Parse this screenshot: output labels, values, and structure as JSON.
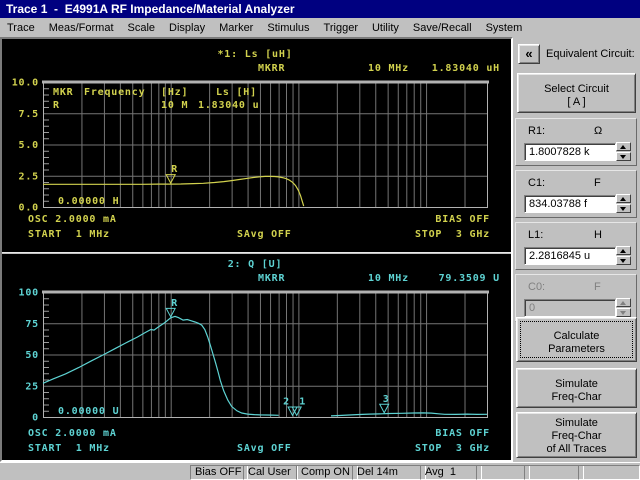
{
  "window_title": "Trace 1  -  E4991A RF Impedance/Material Analyzer",
  "menu": {
    "items": [
      "Trace",
      "Meas/Format",
      "Scale",
      "Display",
      "Marker",
      "Stimulus",
      "Trigger",
      "Utility",
      "Save/Recall",
      "System"
    ]
  },
  "colors": {
    "titlebar": "#000080",
    "trace1": "#d2d24e",
    "trace2": "#5ed3d3",
    "grid": "#757575",
    "plot_border": "#b2b2b2"
  },
  "chart_data": [
    {
      "type": "line",
      "title": "*1: Ls [uH]",
      "readout": {
        "mkr": "MKRR",
        "freq": "10 MHz",
        "value": "1.83040 uH"
      },
      "marker_table": {
        "columns": [
          "MKR",
          "Frequency",
          "[Hz]",
          "Ls [H]"
        ],
        "row": [
          "R",
          "10 M",
          "1.83040 u"
        ]
      },
      "ref_label": "0.00000 H",
      "ylabel_ticks": [
        "10.0",
        "7.5",
        "5.0",
        "2.5",
        "0.0"
      ],
      "ylim": [
        0,
        10
      ],
      "xmin_mhz": 1,
      "xmax_mhz": 3000,
      "xscale": "log",
      "color": "#d2d24e",
      "series": [
        {
          "name": "Ls",
          "segments": [
            [
              [
                1,
                1.82
              ],
              [
                1.5,
                1.82
              ],
              [
                2,
                1.82
              ],
              [
                3,
                1.82
              ],
              [
                4,
                1.82
              ],
              [
                5,
                1.82
              ],
              [
                6,
                1.82
              ],
              [
                8,
                1.83
              ],
              [
                10,
                1.83
              ],
              [
                12,
                1.84
              ],
              [
                15,
                1.87
              ],
              [
                18,
                1.9
              ],
              [
                22,
                1.96
              ],
              [
                26,
                2.03
              ],
              [
                30,
                2.11
              ],
              [
                35,
                2.21
              ],
              [
                40,
                2.3
              ],
              [
                45,
                2.37
              ],
              [
                50,
                2.42
              ],
              [
                55,
                2.445
              ],
              [
                60,
                2.45
              ],
              [
                65,
                2.44
              ],
              [
                70,
                2.41
              ],
              [
                75,
                2.35
              ],
              [
                80,
                2.27
              ],
              [
                85,
                2.15
              ],
              [
                90,
                1.98
              ],
              [
                95,
                1.72
              ],
              [
                100,
                1.33
              ],
              [
                104,
                0.9
              ],
              [
                107,
                0.5
              ],
              [
                110,
                0.07
              ]
            ]
          ]
        }
      ],
      "markers": [
        {
          "label": "R",
          "f_mhz": 10,
          "value": 1.83,
          "label_dx": 4
        }
      ],
      "osc": "OSC 2.0000 mA",
      "bias": "BIAS OFF",
      "start": "START  1 MHz",
      "savg": "SAvg OFF",
      "stop": "STOP  3 GHz"
    },
    {
      "type": "line",
      "title": "2: Q [U]",
      "readout": {
        "mkr": "MKRR",
        "freq": "10 MHz",
        "value": "79.3509 U"
      },
      "ref_label": "0.00000 U",
      "ylabel_ticks": [
        "100",
        "75",
        "50",
        "25",
        "0"
      ],
      "ylim": [
        0,
        100
      ],
      "xmin_mhz": 1,
      "xmax_mhz": 3000,
      "xscale": "log",
      "color": "#5ed3d3",
      "series": [
        {
          "name": "Q",
          "segments": [
            [
              [
                1,
                27
              ],
              [
                1.2,
                30.5
              ],
              [
                1.5,
                34.5
              ],
              [
                1.9,
                39.5
              ],
              [
                2.4,
                45
              ],
              [
                3,
                50
              ],
              [
                3.7,
                55
              ],
              [
                4.5,
                59.5
              ],
              [
                5.5,
                64
              ],
              [
                6.3,
                67.5
              ],
              [
                7,
                70
              ],
              [
                7.4,
                69.5
              ],
              [
                8,
                72
              ],
              [
                9,
                75.5
              ],
              [
                10,
                79.35
              ],
              [
                10.8,
                80.5
              ],
              [
                11.5,
                79.5
              ],
              [
                12.5,
                77.5
              ],
              [
                13.5,
                78
              ],
              [
                14.5,
                77
              ],
              [
                15.5,
                76
              ],
              [
                16.5,
                75
              ],
              [
                17.5,
                73.5
              ],
              [
                18.5,
                70
              ],
              [
                19.5,
                64
              ],
              [
                20.5,
                57
              ],
              [
                21.5,
                50
              ],
              [
                22.5,
                43
              ],
              [
                23.5,
                36
              ],
              [
                24.5,
                29
              ],
              [
                26,
                21
              ],
              [
                28,
                13.5
              ],
              [
                30,
                8.5
              ],
              [
                33,
                5
              ],
              [
                36,
                3.2
              ],
              [
                40,
                2.3
              ],
              [
                45,
                1.9
              ],
              [
                50,
                1.7
              ],
              [
                56,
                1.6
              ],
              [
                63,
                1.5
              ],
              [
                70,
                1.4
              ]
            ],
            [
              [
                180,
                0.9
              ],
              [
                210,
                1.2
              ],
              [
                250,
                1.6
              ],
              [
                300,
                2.0
              ],
              [
                360,
                2.3
              ],
              [
                430,
                2.5
              ],
              [
                520,
                2.8
              ],
              [
                640,
                3.0
              ],
              [
                800,
                3.2
              ],
              [
                950,
                3.3
              ],
              [
                1100,
                3.1
              ],
              [
                1250,
                2.6
              ],
              [
                1400,
                2.2
              ],
              [
                1700,
                2.1
              ],
              [
                2100,
                2.3
              ],
              [
                2500,
                2.1
              ],
              [
                3000,
                2.2
              ]
            ]
          ]
        }
      ],
      "markers": [
        {
          "label": "R",
          "f_mhz": 10,
          "value": 79.35,
          "label_dx": 4
        },
        {
          "label": "2",
          "f_mhz": 90,
          "value": 0.45,
          "label_dx": -6
        },
        {
          "label": "1",
          "f_mhz": 97,
          "value": 0.45,
          "label_dx": 6
        },
        {
          "label": "3",
          "f_mhz": 470,
          "value": 2.6,
          "label_dx": 2
        }
      ],
      "osc": "OSC 2.0000 mA",
      "bias": "BIAS OFF",
      "start": "START  1 MHz",
      "savg": "SAvg OFF",
      "stop": "STOP  3 GHz"
    }
  ],
  "side_panel": {
    "collapse_glyph": "«",
    "title": "Equivalent Circuit:",
    "select_circuit": [
      "Select Circuit",
      "[ A ]"
    ],
    "parameters": [
      {
        "name": "R1:",
        "unit": "Ω",
        "value": "1.8007828 k",
        "enabled": true
      },
      {
        "name": "C1:",
        "unit": "F",
        "value": "834.03788 f",
        "enabled": true
      },
      {
        "name": "L1:",
        "unit": "H",
        "value": "2.2816845 u",
        "enabled": true
      },
      {
        "name": "C0:",
        "unit": "F",
        "value": "0",
        "enabled": false
      }
    ],
    "calculate_button": [
      "Calculate",
      "Parameters"
    ],
    "simulate_button": [
      "Simulate",
      "Freq-Char"
    ],
    "simulate_all_button": [
      "Simulate",
      "Freq-Char",
      "of All Traces"
    ]
  },
  "status_bar": {
    "cells": [
      "Bias OFF",
      "Cal User",
      "Comp ON",
      "Del 14m",
      "Avg  1",
      "",
      "",
      ""
    ]
  }
}
